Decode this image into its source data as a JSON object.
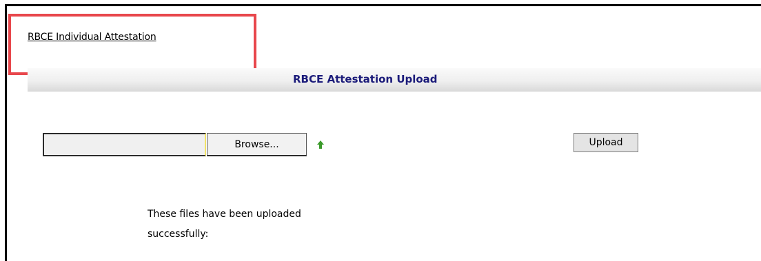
{
  "link": {
    "label": "RBCE Individual Attestation"
  },
  "header": {
    "title": "RBCE Attestation Upload"
  },
  "file_picker": {
    "value": "",
    "browse_label": "Browse..."
  },
  "upload": {
    "label": "Upload"
  },
  "message": {
    "line1": "These files have been uploaded",
    "line2": "successfully:"
  },
  "colors": {
    "highlight_box": "#e8474c",
    "header_title": "#1b1b7a",
    "arrow_icon": "#3a9a2a"
  },
  "icons": {
    "add_more": "green-up-arrow-icon"
  }
}
